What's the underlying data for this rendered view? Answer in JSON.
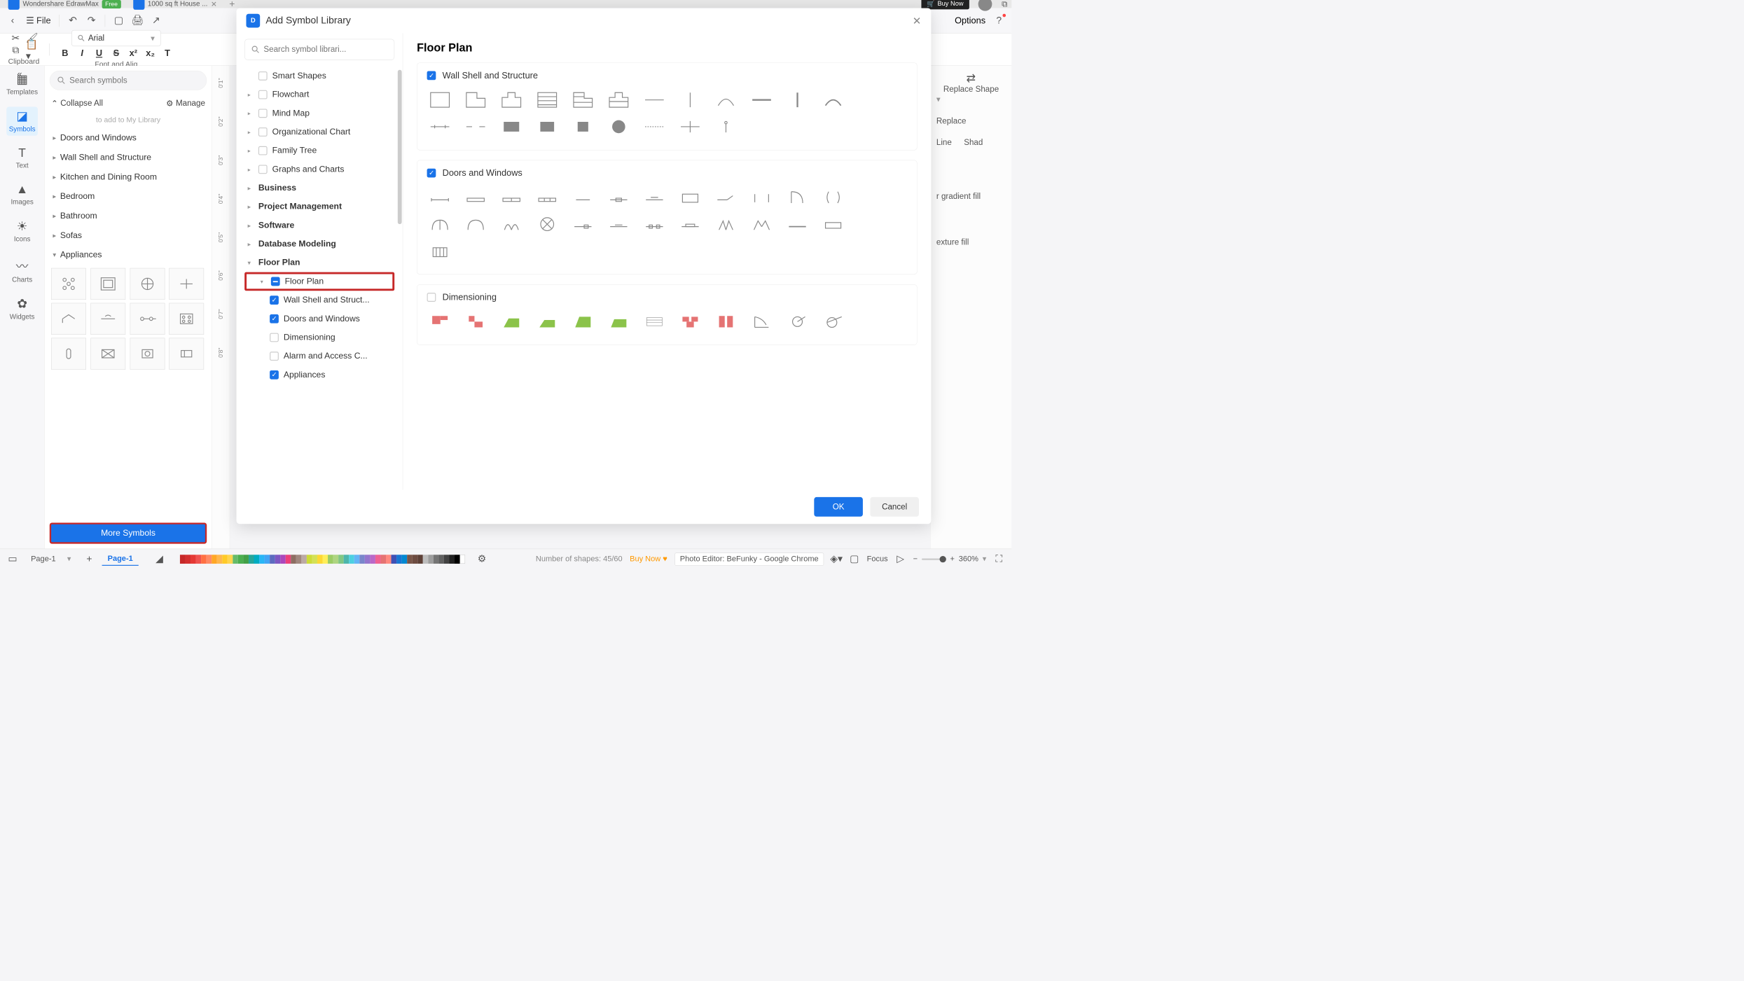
{
  "tabs": {
    "app_name": "Wondershare EdrawMax",
    "free_badge": "Free",
    "doc_tab": "1000 sq ft House ...",
    "buy_now": "Buy Now"
  },
  "toolbar": {
    "file": "File",
    "options": "Options"
  },
  "font": {
    "family": "Arial",
    "clipboard_label": "Clipboard",
    "font_align_label": "Font and Alig"
  },
  "rail": {
    "templates": "Templates",
    "symbols": "Symbols",
    "text": "Text",
    "images": "Images",
    "icons": "Icons",
    "charts": "Charts",
    "widgets": "Widgets"
  },
  "symbols_panel": {
    "search_placeholder": "Search symbols",
    "collapse": "Collapse All",
    "manage": "Manage",
    "hint": "to add to My Library",
    "cats": [
      "Doors and Windows",
      "Wall Shell and Structure",
      "Kitchen and Dining Room",
      "Bedroom",
      "Bathroom",
      "Sofas",
      "Appliances"
    ],
    "more": "More Symbols"
  },
  "ruler": [
    "0'1\"",
    "0'2\"",
    "0'3\"",
    "0'4\"",
    "0'5\"",
    "0'6\"",
    "0'7\"",
    "0'8\""
  ],
  "modal": {
    "title": "Add Symbol Library",
    "search_placeholder": "Search symbol librari...",
    "content_title": "Floor Plan",
    "tree": {
      "smart_shapes": "Smart Shapes",
      "flowchart": "Flowchart",
      "mind_map": "Mind Map",
      "org_chart": "Organizational Chart",
      "family_tree": "Family Tree",
      "graphs": "Graphs and Charts",
      "business": "Business",
      "project": "Project Management",
      "software": "Software",
      "database": "Database Modeling",
      "floor_plan": "Floor Plan",
      "floor_plan_sub": "Floor Plan",
      "wall_shell": "Wall Shell and Struct...",
      "doors_windows": "Doors and Windows",
      "dimensioning": "Dimensioning",
      "alarm": "Alarm and Access C...",
      "appliances": "Appliances"
    },
    "groups": {
      "wall": "Wall Shell and Structure",
      "doors": "Doors and Windows",
      "dim": "Dimensioning"
    },
    "ok": "OK",
    "cancel": "Cancel"
  },
  "right": {
    "replace_shape": "Replace Shape",
    "replace": "Replace",
    "line": "Line",
    "shad": "Shad",
    "gradient": "r gradient fill",
    "texture": "exture fill"
  },
  "footer": {
    "page_select": "Page-1",
    "page_active": "Page-1",
    "shapes_count": "Number of shapes: 45/60",
    "buy_now": "Buy Now",
    "photo_editor": "Photo Editor: BeFunky - Google Chrome",
    "focus": "Focus",
    "zoom": "360%"
  }
}
